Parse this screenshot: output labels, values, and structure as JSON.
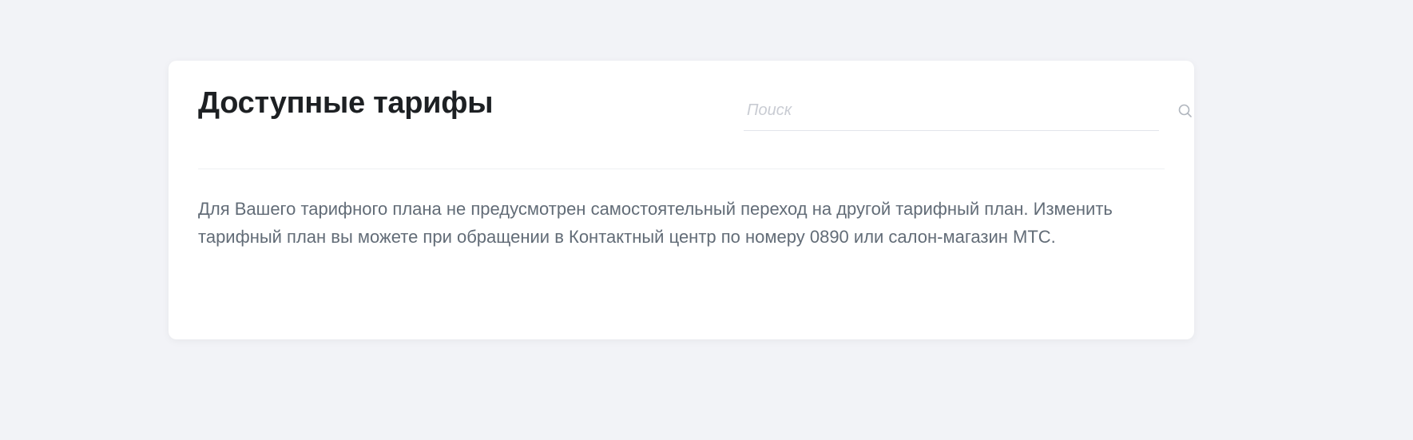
{
  "card": {
    "title": "Доступные тарифы",
    "search": {
      "placeholder": "Поиск",
      "value": "",
      "icon": "search-icon"
    },
    "description": "Для Вашего тарифного плана не предусмотрен самостоятельный переход на другой тарифный план. Изменить тарифный план вы можете при обращении в Контактный центр по номеру 0890 или салон-магазин МТС."
  },
  "colors": {
    "background": "#f2f3f7",
    "card": "#ffffff",
    "title": "#1d2023",
    "text": "#626c77",
    "placeholder": "#c9ccd3",
    "divider": "#eef0f3"
  }
}
